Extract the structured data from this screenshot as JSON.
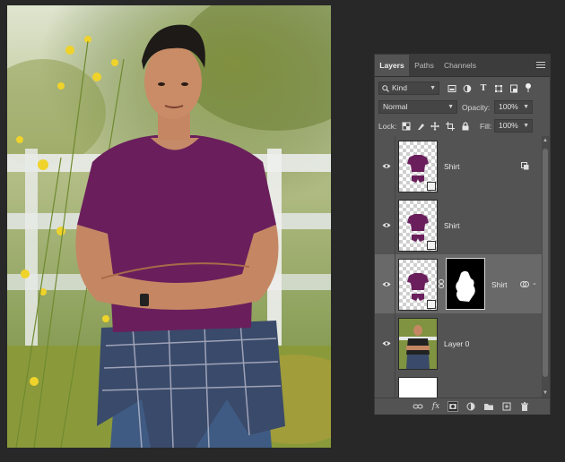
{
  "panel": {
    "tabs": [
      "Layers",
      "Paths",
      "Channels"
    ],
    "filter": {
      "label": "Kind"
    },
    "blend_mode": "Normal",
    "opacity": {
      "label": "Opacity:",
      "value": "100%"
    },
    "lock": {
      "label": "Lock:"
    },
    "fill": {
      "label": "Fill:",
      "value": "100%"
    }
  },
  "layers": [
    {
      "name": "Shirt"
    },
    {
      "name": "Shirt"
    },
    {
      "name": "Shirt"
    },
    {
      "name": "Layer 0"
    }
  ],
  "colors": {
    "shirt": "#6a1f5c",
    "panel_bg": "#535353",
    "selected_row": "#696969",
    "workspace": "#282828"
  }
}
